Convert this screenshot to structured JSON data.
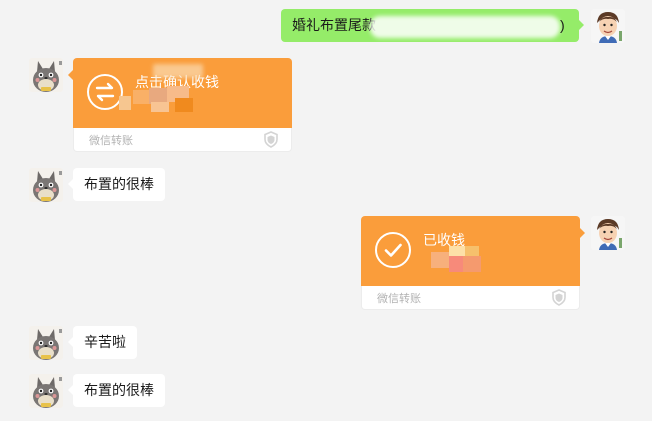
{
  "messages": {
    "m1": {
      "text": "婚礼布置尾款"
    },
    "m2": {
      "title": "点击确认收钱",
      "footer": "微信转账"
    },
    "m3": {
      "text": "布置的很棒"
    },
    "m4": {
      "title": "已收钱",
      "footer": "微信转账"
    },
    "m5": {
      "text": "辛苦啦"
    },
    "m6": {
      "text": "布置的很棒"
    }
  },
  "colors": {
    "background": "#f3f3f3",
    "green_bubble": "#95ec69",
    "transfer_orange": "#fa9d3b",
    "white_bubble": "#ffffff"
  },
  "icons": {
    "contact_avatar": "gray-totoro-avatar",
    "self_avatar": "cartoon-man-avatar",
    "pending_transfer": "two-way-arrows-icon",
    "received_transfer": "checkmark-icon",
    "transfer_footer": "shield-icon"
  }
}
